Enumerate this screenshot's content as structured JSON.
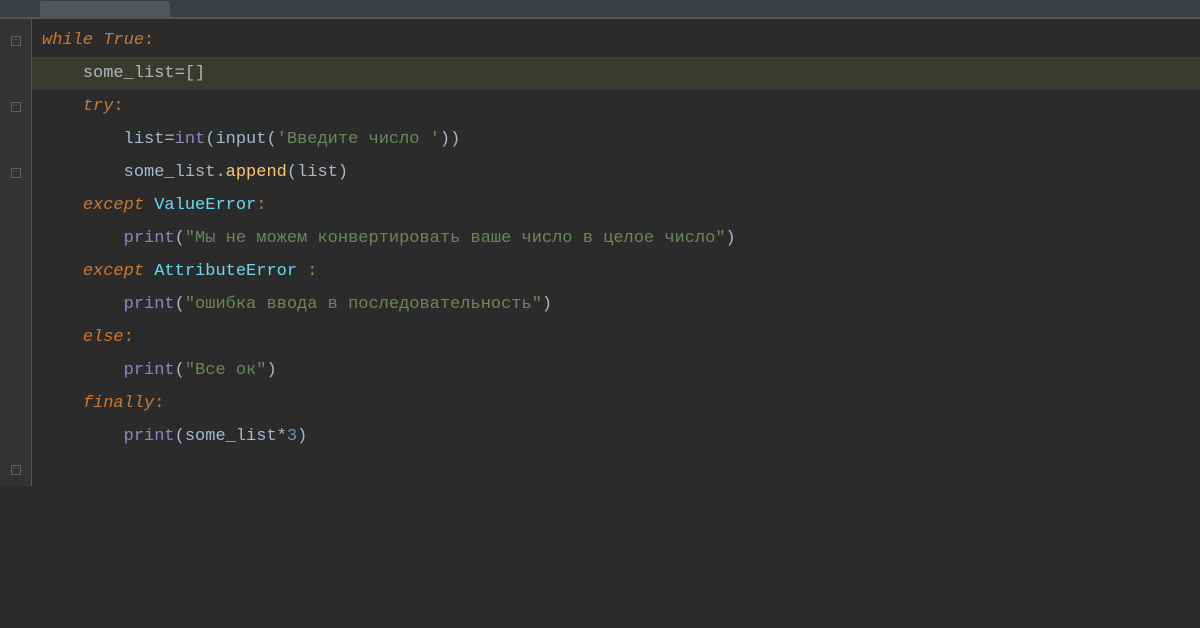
{
  "tab": {
    "label": ""
  },
  "code": {
    "while": "while",
    "true": "True",
    "some_list": "some_list",
    "empty_list": "[]",
    "try": "try",
    "list_var": "list",
    "int": "int",
    "input": "input",
    "input_prompt": "'Введите число '",
    "append": "append",
    "except": "except",
    "ValueError": "ValueError",
    "AttributeError": "AttributeError",
    "print": "print",
    "msg_value_error": "\"Мы не можем конвертировать ваше число в целое число\"",
    "msg_attr_error": "\"ошибка ввода в последовательность\"",
    "else": "else",
    "msg_ok": "\"Все ок\"",
    "finally": "finally",
    "times3": "3",
    "eq": "=",
    "star": "*",
    "colon": ":",
    "space": " "
  }
}
